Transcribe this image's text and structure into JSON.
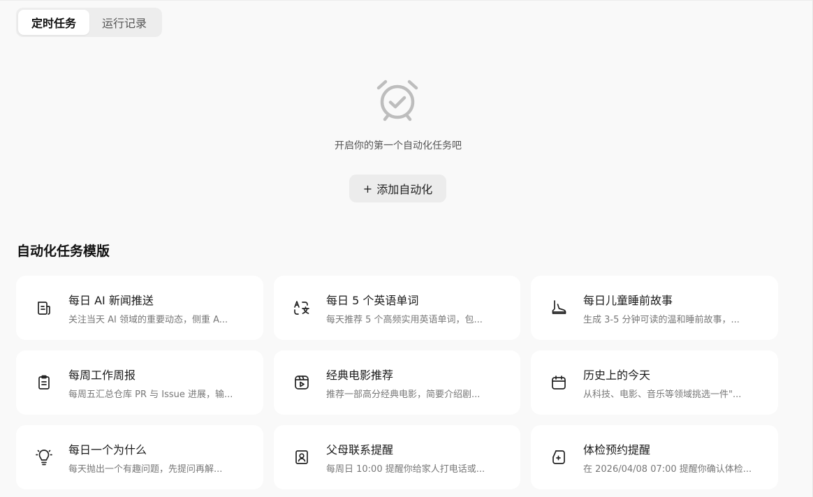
{
  "tabs": [
    {
      "label": "定时任务",
      "active": true
    },
    {
      "label": "运行记录",
      "active": false
    }
  ],
  "empty_state": {
    "icon": "alarm-clock-check-icon",
    "message": "开启你的第一个自动化任务吧",
    "add_button_label": "添加自动化",
    "add_button_icon": "+"
  },
  "templates_title": "自动化任务模版",
  "templates": [
    {
      "icon": "news-icon",
      "title": "每日 AI 新闻推送",
      "desc": "关注当天 AI 领域的重要动态，侧重 A..."
    },
    {
      "icon": "translate-icon",
      "title": "每日 5 个英语单词",
      "desc": "每天推荐 5 个高频实用英语单词，包..."
    },
    {
      "icon": "boot-icon",
      "title": "每日儿童睡前故事",
      "desc": "生成 3-5 分钟可读的温和睡前故事，..."
    },
    {
      "icon": "clipboard-icon",
      "title": "每周工作周报",
      "desc": "每周五汇总仓库 PR 与 Issue 进展，输..."
    },
    {
      "icon": "film-play-icon",
      "title": "经典电影推荐",
      "desc": "推荐一部高分经典电影，简要介绍剧..."
    },
    {
      "icon": "calendar-icon",
      "title": "历史上的今天",
      "desc": "从科技、电影、音乐等领域挑选一件\"..."
    },
    {
      "icon": "lightbulb-icon",
      "title": "每日一个为什么",
      "desc": "每天抛出一个有趣问题，先提问再解..."
    },
    {
      "icon": "contact-book-icon",
      "title": "父母联系提醒",
      "desc": "每周日 10:00 提醒你给家人打电话或..."
    },
    {
      "icon": "medical-checkup-icon",
      "title": "体检预约提醒",
      "desc": "在 2026/04/08 07:00 提醒你确认体检..."
    }
  ]
}
